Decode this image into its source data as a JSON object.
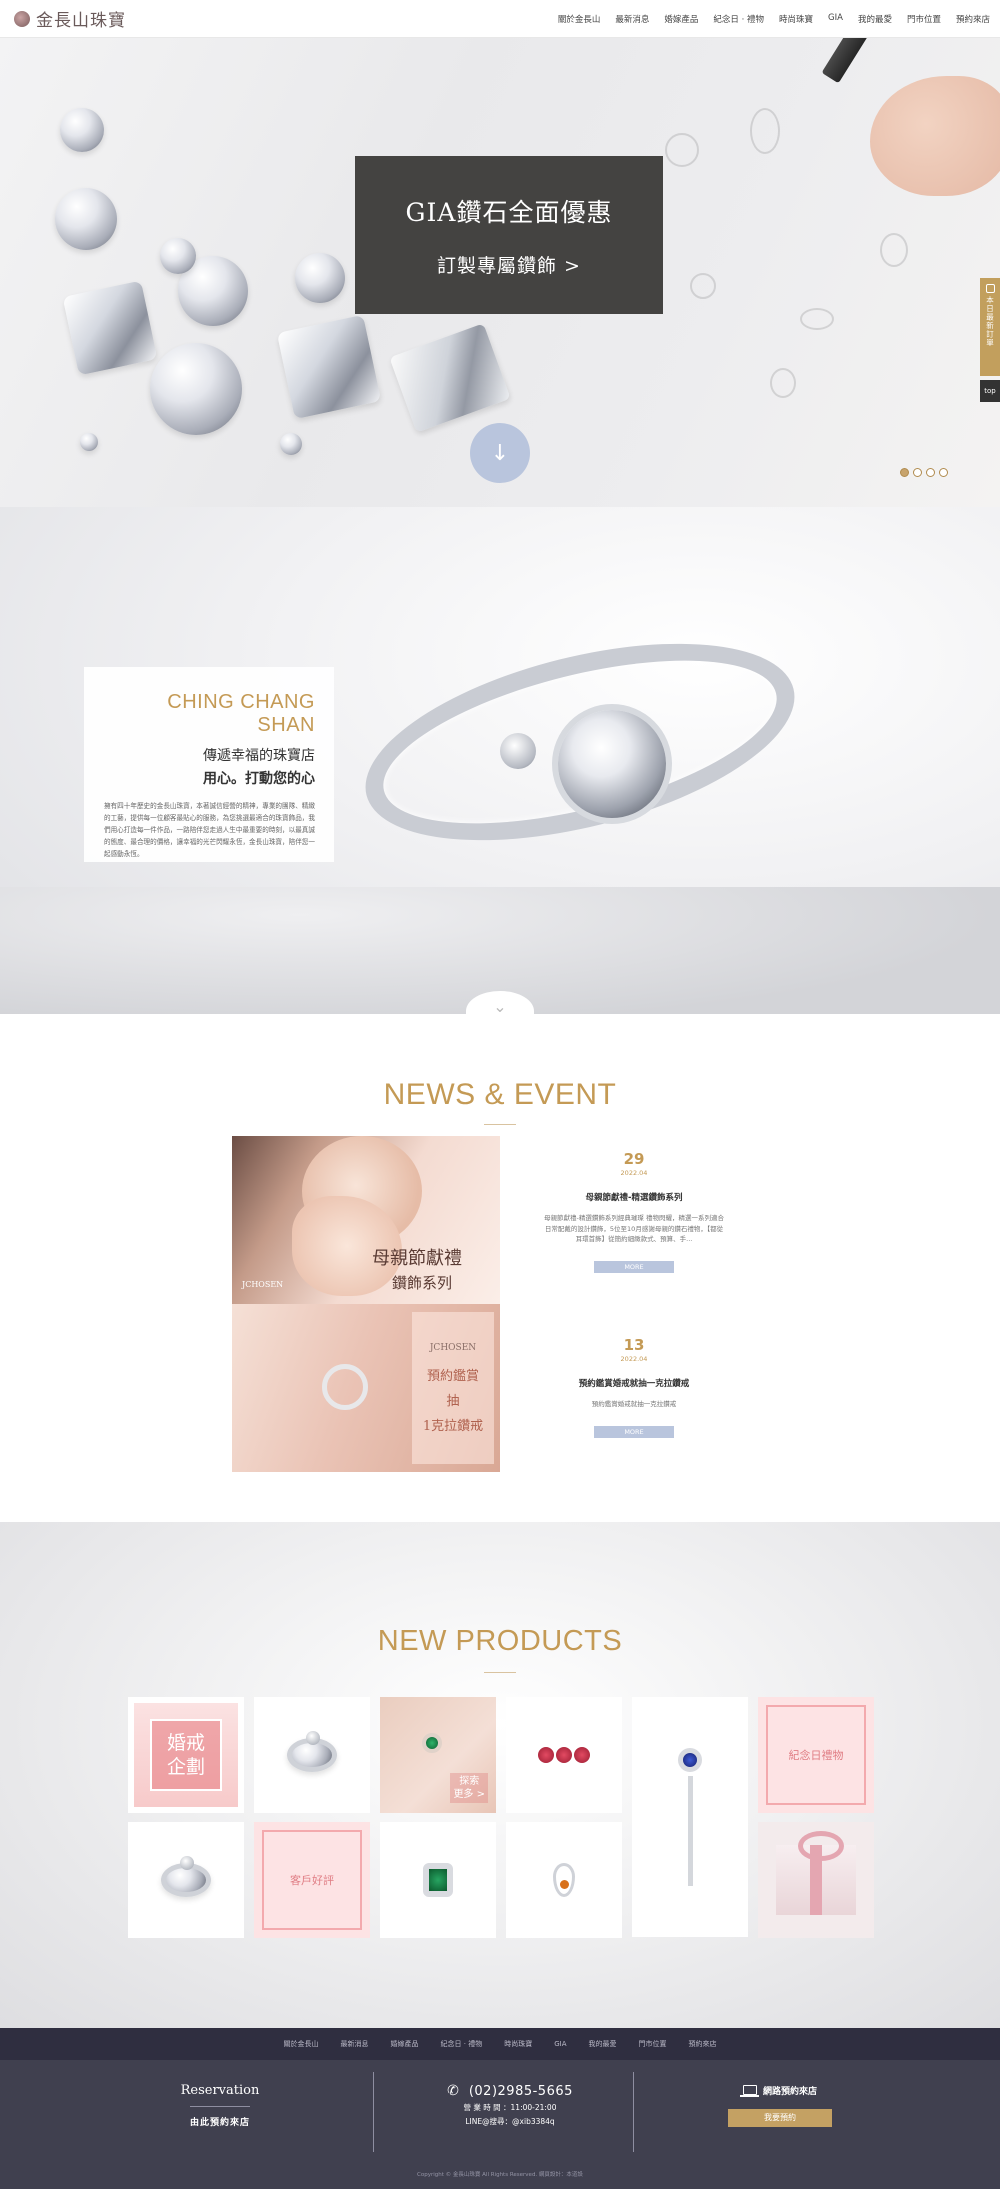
{
  "header": {
    "logo_text": "金長山珠寶",
    "nav": [
      "關於金長山",
      "最新消息",
      "婚嫁產品",
      "紀念日 · 禮物",
      "時尚珠寶",
      "GIA",
      "我的最愛",
      "門市位置",
      "預約來店"
    ]
  },
  "hero": {
    "promo_title": "GIA鑽石全面優惠",
    "promo_sub": "訂製專屬鑽飾 >",
    "slide_count": 4,
    "active_slide": 1,
    "side_tab": "本日最新訂單",
    "top_label": "top"
  },
  "about": {
    "title_en": "CHING CHANG SHAN",
    "line1": "傳遞幸福的珠寶店",
    "line2": "用心。打動您的心",
    "body": "擁有四十年歷史的金長山珠寶，本著誠信經營的精神，專業的團隊、精緻的工藝，提供每一位顧客最貼心的服務，為您挑選最適合的珠寶飾品，我們用心打造每一件作品，一路陪伴您走過人生中最重要的時刻，以最真誠的態度、最合理的價格，讓幸福的光芒閃耀永恆，金長山珠寶，陪伴您一起感動永恆。"
  },
  "news": {
    "title": "NEWS & EVENT",
    "image1_caption": "母親節獻禮",
    "image1_caption2": "鑽飾系列",
    "image1_brand": "JCHOSEN",
    "image2_brand": "JCHOSEN",
    "image2_lines": [
      "預約鑑賞",
      "抽",
      "1克拉鑽戒"
    ],
    "events": [
      {
        "day": "29",
        "month": "2022.04",
        "title": "母親節獻禮-精選鑽飾系列",
        "desc": "母親節獻禮-精選鑽飾系列經典璀璨 禮物閃耀，精選一系列適合日常配戴的設計鑽飾，5位至10月感謝母親的鑽石禮物，【都從耳環首飾】從簡約細緻款式、預算、手...",
        "more": "MORE"
      },
      {
        "day": "13",
        "month": "2022.04",
        "title": "預約鑑賞婚戒就抽一克拉鑽戒",
        "desc": "預約鑑賞婚戒就抽一克拉鑽戒",
        "more": "MORE"
      }
    ]
  },
  "products": {
    "title": "NEW PRODUCTS",
    "wedding_plan": [
      "婚戒",
      "企劃"
    ],
    "explore": [
      "探索",
      "更多 >"
    ],
    "anniversary": "紀念日禮物",
    "reviews": "客戶好評"
  },
  "footer": {
    "menu": [
      "關於金長山",
      "最新消息",
      "婚嫁產品",
      "紀念日 · 禮物",
      "時尚珠寶",
      "GIA",
      "我的最愛",
      "門市位置",
      "預約來店"
    ],
    "reservation_title": "Reservation",
    "reservation_sub": "由此預約來店",
    "phone": "(02)2985-5665",
    "hours": "營 業 時 間 ：11:00-21:00",
    "line": "LINE@搜尋：@xib3384q",
    "book_label": "網路預約來店",
    "book_button": "我要預約",
    "copyright": "Copyright © 金長山珠寶 All Rights Reserved.  網頁設計：本道設"
  },
  "colors": {
    "gold": "#C49A55",
    "footer_bg": "#40404F",
    "menu_bg": "#2F2E40",
    "soft_blue": "#B9C5DD",
    "promo_bg": "#444341"
  }
}
